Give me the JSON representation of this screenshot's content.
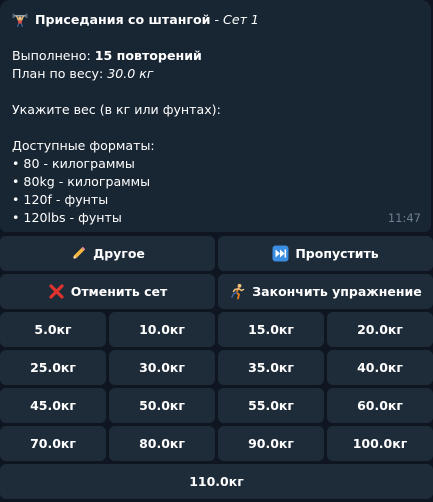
{
  "message": {
    "title": "Приседания со штангой",
    "title_sep": " - ",
    "set_label": "Сет 1",
    "done_label": "Выполнено: ",
    "done_value": "15 повторений",
    "plan_label": "План по весу: ",
    "plan_value": "30.0 кг",
    "prompt": "Укажите вес (в кг или фунтах):",
    "formats_title": "Доступные форматы:",
    "formats": [
      "• 80 - килограммы",
      "• 80kg - килограммы",
      "• 120f - фунты",
      "• 120lbs - фунты"
    ],
    "time": "11:47"
  },
  "keyboard": {
    "other": "Другое",
    "skip": "Пропустить",
    "cancel_set": "Отменить сет",
    "finish_exercise": "Закончить упражнение",
    "weights": [
      "5.0кг",
      "10.0кг",
      "15.0кг",
      "20.0кг",
      "25.0кг",
      "30.0кг",
      "35.0кг",
      "40.0кг",
      "45.0кг",
      "50.0кг",
      "55.0кг",
      "60.0кг",
      "70.0кг",
      "80.0кг",
      "90.0кг",
      "100.0кг",
      "110.0кг"
    ]
  },
  "icons": {
    "title": "weightlifter-icon",
    "other": "pencil-icon",
    "skip": "fast-forward-icon",
    "cancel": "red-cross-icon",
    "finish": "runner-icon"
  },
  "colors": {
    "background": "#0f1621",
    "bubble": "#182533",
    "button": "#1e2c3a",
    "timestamp": "#6d7f8f",
    "cancel_red": "#e0322f",
    "skip_blue": "#3a8de0"
  }
}
